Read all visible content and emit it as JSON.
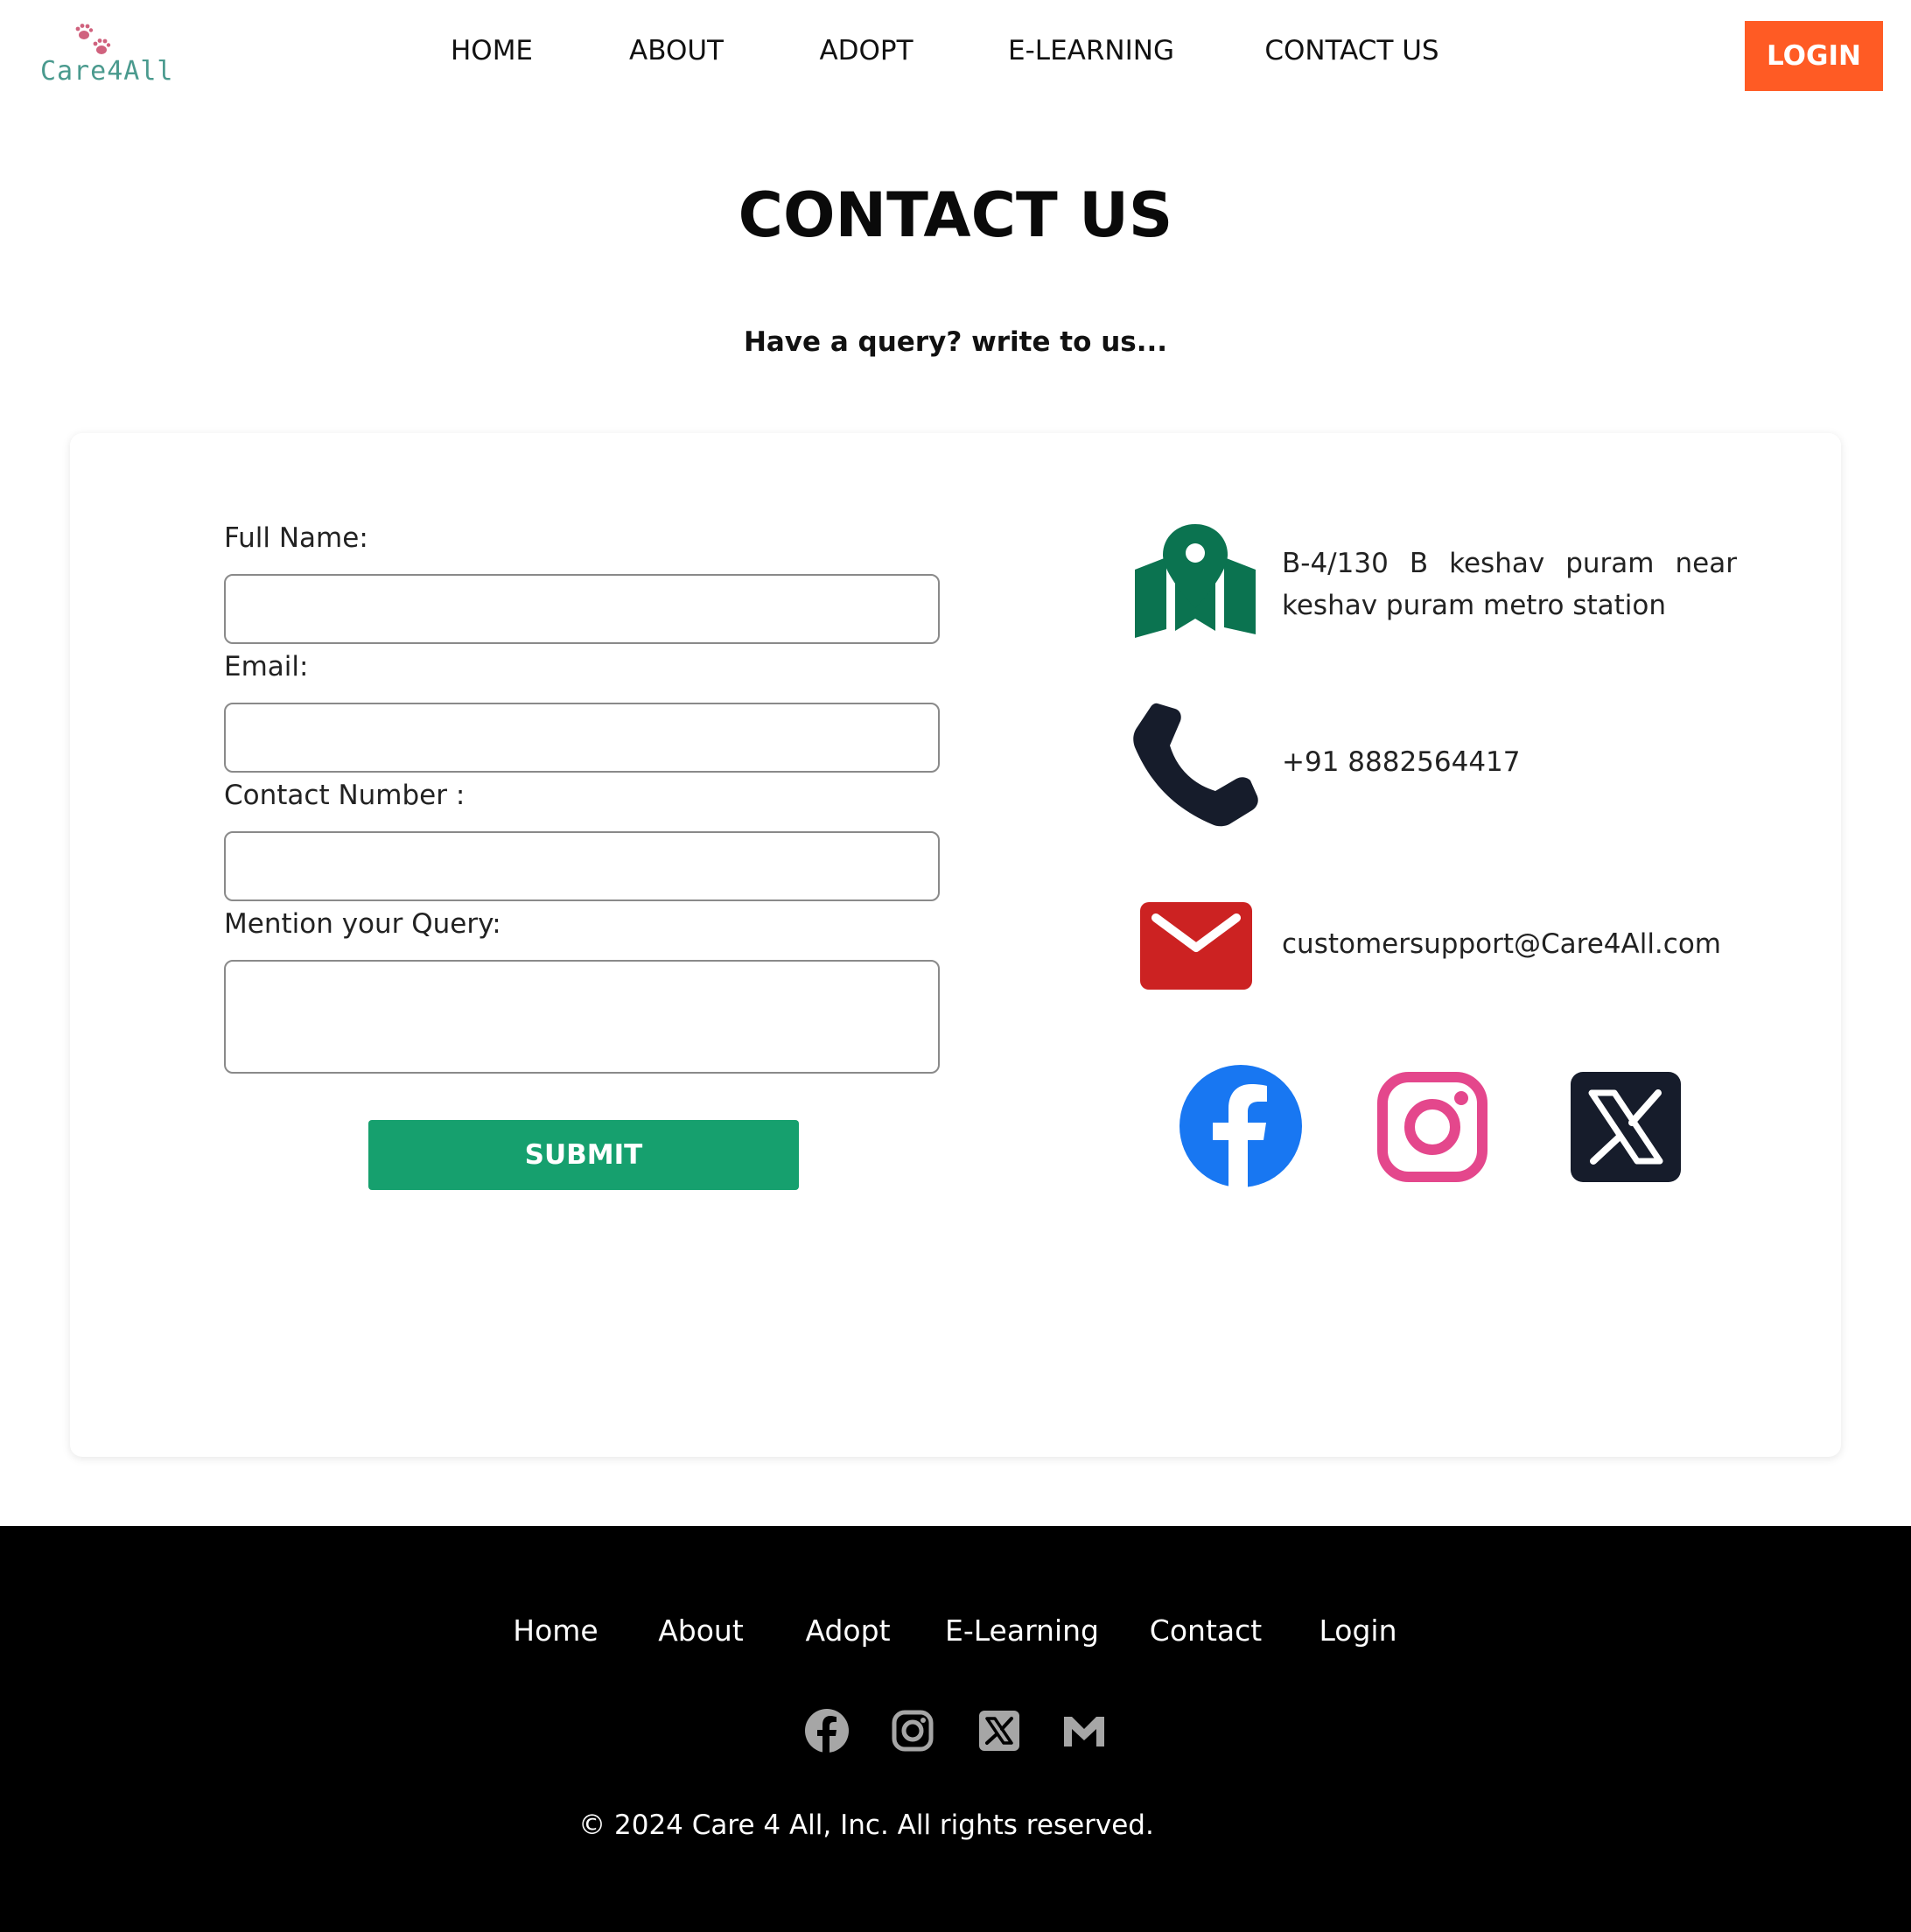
{
  "header": {
    "logo_text": "Care4All",
    "nav": [
      "HOME",
      "ABOUT",
      "ADOPT",
      "E-LEARNING",
      "CONTACT US"
    ],
    "login_label": "LOGIN"
  },
  "hero": {
    "title": "CONTACT US",
    "subtitle": "Have a query? write to us..."
  },
  "form": {
    "full_name_label": "Full Name:",
    "full_name_value": "",
    "email_label": "Email:",
    "email_value": "",
    "contact_label": "Contact Number :",
    "contact_value": "",
    "query_label": "Mention your Query:",
    "query_value": "",
    "submit_label": "SUBMIT"
  },
  "contact_info": {
    "address": "B-4/130 B keshav puram near keshav puram metro station",
    "phone": "+91 8882564417",
    "email": "customersupport@Care4All.com",
    "social": [
      "facebook-icon",
      "instagram-icon",
      "x-icon"
    ]
  },
  "footer": {
    "links": [
      "Home",
      "About",
      "Adopt",
      "E-Learning",
      "Contact",
      "Login"
    ],
    "icons": [
      "facebook-icon",
      "instagram-icon",
      "x-icon",
      "gmail-icon"
    ],
    "copyright": "© 2024 Care 4 All, Inc. All rights reserved."
  },
  "colors": {
    "accent_orange": "#ff5b24",
    "submit_green": "#16a06e",
    "map_green": "#0b7350",
    "mail_red": "#cc2222",
    "facebook_blue": "#1877f2",
    "instagram_pink": "#e4478c",
    "footer_bg": "#000000"
  }
}
